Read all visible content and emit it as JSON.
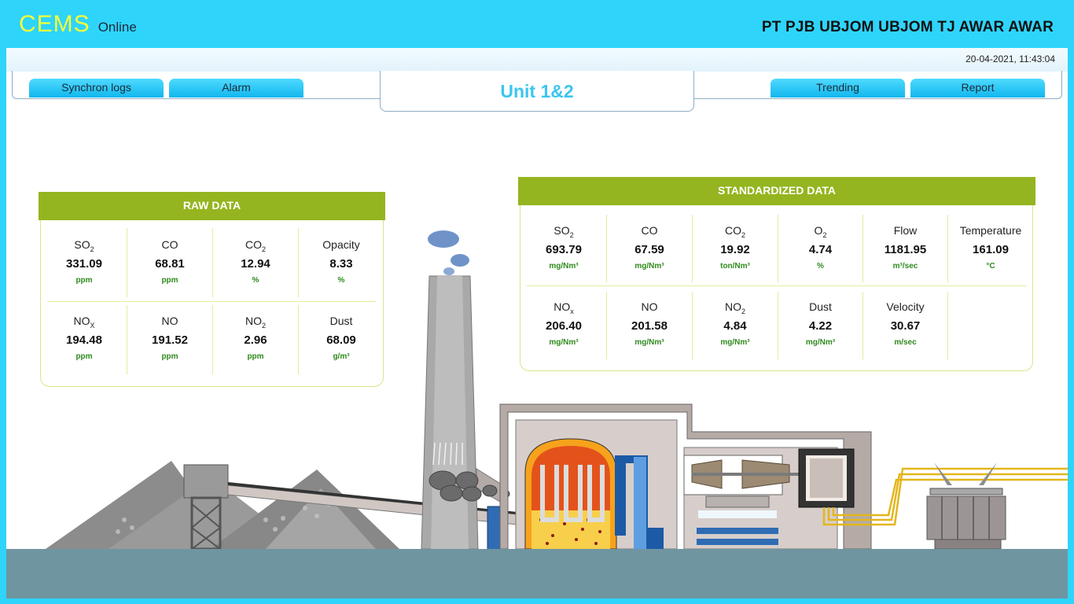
{
  "header": {
    "brand_main": "CEMS",
    "brand_sub": "Online",
    "company": "PT PJB UBJOM UBJOM TJ AWAR AWAR",
    "datetime": "20-04-2021, 11:43:04"
  },
  "nav": {
    "synchron_logs": "Synchron logs",
    "alarm": "Alarm",
    "trending": "Trending",
    "report": "Report",
    "unit_title": "Unit 1&2"
  },
  "raw": {
    "title": "RAW DATA",
    "so2": {
      "name": "SO",
      "sub": "2",
      "value": "331.09",
      "unit": "ppm"
    },
    "co": {
      "name": "CO",
      "sub": "",
      "value": "68.81",
      "unit": "ppm"
    },
    "co2": {
      "name": "CO",
      "sub": "2",
      "value": "12.94",
      "unit": "%"
    },
    "opacity": {
      "name": "Opacity",
      "sub": "",
      "value": "8.33",
      "unit": "%"
    },
    "nox": {
      "name": "NO",
      "sub": "X",
      "value": "194.48",
      "unit": "ppm"
    },
    "no": {
      "name": "NO",
      "sub": "",
      "value": "191.52",
      "unit": "ppm"
    },
    "no2": {
      "name": "NO",
      "sub": "2",
      "value": "2.96",
      "unit": "ppm"
    },
    "dust": {
      "name": "Dust",
      "sub": "",
      "value": "68.09",
      "unit": "g/m³"
    }
  },
  "std": {
    "title": "STANDARDIZED DATA",
    "so2": {
      "name": "SO",
      "sub": "2",
      "value": "693.79",
      "unit": "mg/Nm³"
    },
    "co": {
      "name": "CO",
      "sub": "",
      "value": "67.59",
      "unit": "mg/Nm³"
    },
    "co2": {
      "name": "CO",
      "sub": "2",
      "value": "19.92",
      "unit": "ton/Nm³"
    },
    "o2": {
      "name": "O",
      "sub": "2",
      "value": "4.74",
      "unit": "%"
    },
    "flow": {
      "name": "Flow",
      "sub": "",
      "value": "1181.95",
      "unit": "m³/sec"
    },
    "temperature": {
      "name": "Temperature",
      "sub": "",
      "value": "161.09",
      "unit": "°C"
    },
    "nox": {
      "name": "NO",
      "sub": "x",
      "value": "206.40",
      "unit": "mg/Nm³"
    },
    "no": {
      "name": "NO",
      "sub": "",
      "value": "201.58",
      "unit": "mg/Nm³"
    },
    "no2": {
      "name": "NO",
      "sub": "2",
      "value": "4.84",
      "unit": "mg/Nm³"
    },
    "dust": {
      "name": "Dust",
      "sub": "",
      "value": "4.22",
      "unit": "mg/Nm³"
    },
    "velocity": {
      "name": "Velocity",
      "sub": "",
      "value": "30.67",
      "unit": "m/sec"
    }
  },
  "colors": {
    "accent": "#2fd4fb",
    "panel_header": "#94b51f",
    "unit_text": "#2f8a1e",
    "brand": "#f4ff3a"
  }
}
